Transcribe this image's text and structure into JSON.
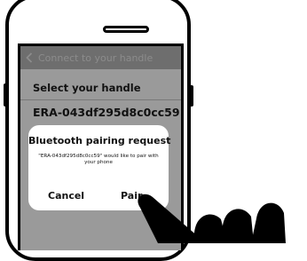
{
  "header": {
    "back_icon": "chevron-left-icon",
    "title": "Connect to your handle"
  },
  "list": {
    "heading": "Select your handle",
    "device_name": "ERA-043df295d8c0cc59"
  },
  "dialog": {
    "title": "Bluetooth pairing request",
    "message": "\"ERA-043df295d8c0cc59\" would like to pair with your phone",
    "cancel_label": "Cancel",
    "pair_label": "Pair"
  },
  "colors": {
    "screen_dim": "#9a9a9a",
    "nav_bar": "#6e6e6e",
    "dialog_bg": "#ffffff",
    "outline": "#000000"
  }
}
